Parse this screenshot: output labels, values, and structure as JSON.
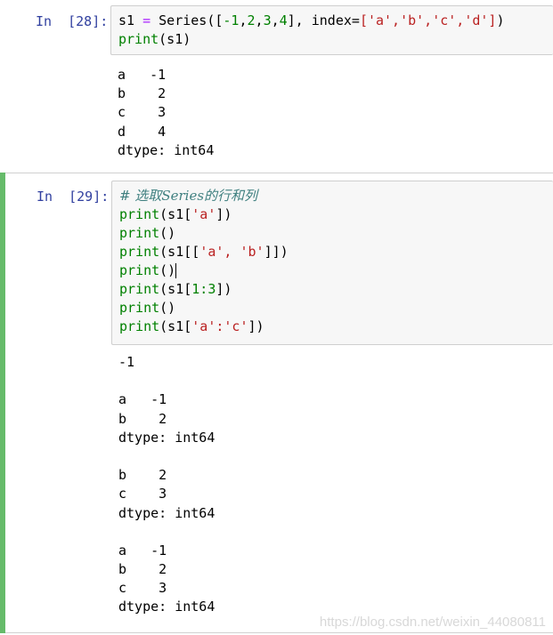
{
  "cell1": {
    "prompt": "In  [28]:",
    "code": {
      "line1": {
        "a": "s1",
        "b": " = ",
        "c": "Series([",
        "d": "-1",
        "e": ",",
        "f": "2",
        "g": ",",
        "h": "3",
        "i": ",",
        "j": "4",
        "k": "], index=",
        "l": "['a','b','c','d']",
        "m": ")"
      },
      "line2": {
        "kw": "print",
        "rest": "(s1)"
      }
    },
    "output": [
      "a   -1",
      "b    2",
      "c    3",
      "d    4",
      "dtype: int64"
    ]
  },
  "cell2": {
    "prompt": "In  [29]:",
    "code": {
      "comment": "# 选取Series的行和列",
      "l2": {
        "kw": "print",
        "a": "(s1[",
        "str": "'a'",
        "b": "])"
      },
      "l3": {
        "kw": "print",
        "a": "()"
      },
      "l4": {
        "kw": "print",
        "a": "(s1[[",
        "str": "'a', 'b'",
        "b": "]])"
      },
      "l5": {
        "kw": "print",
        "a": "()"
      },
      "l6": {
        "kw": "print",
        "a": "(s1[",
        "num": "1:3",
        "b": "])"
      },
      "l7": {
        "kw": "print",
        "a": "()"
      },
      "l8": {
        "kw": "print",
        "a": "(s1[",
        "str": "'a':'c'",
        "b": "])"
      }
    },
    "output": [
      "-1",
      "",
      "a   -1",
      "b    2",
      "dtype: int64",
      "",
      "b    2",
      "c    3",
      "dtype: int64",
      "",
      "a   -1",
      "b    2",
      "c    3",
      "dtype: int64"
    ]
  },
  "watermark": "https://blog.csdn.net/weixin_44080811"
}
